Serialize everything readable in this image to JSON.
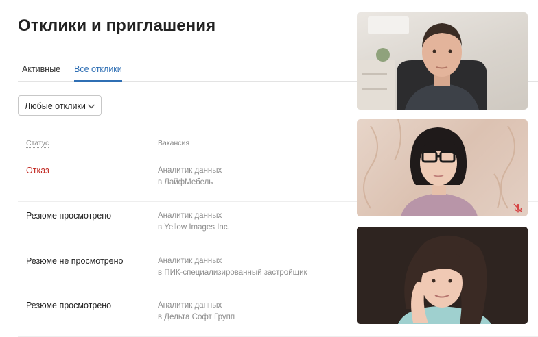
{
  "header": {
    "title": "Отклики и приглашения"
  },
  "tabs": [
    {
      "label": "Активные"
    },
    {
      "label": "Все отклики"
    }
  ],
  "filter": {
    "selected": "Любые отклики"
  },
  "table": {
    "columns": {
      "status": "Статус",
      "vacancy": "Вакансия"
    },
    "rows": [
      {
        "status": "Отказ",
        "vacancy": "Аналитик данных",
        "company": "в ЛайфМебель"
      },
      {
        "status": "Резюме просмотрено",
        "vacancy": "Аналитик данных",
        "company": "в Yellow Images Inc."
      },
      {
        "status": "Резюме не просмотрено",
        "vacancy": "Аналитик данных",
        "company": "в ПИК-специализированный застройщик"
      },
      {
        "status": "Резюме просмотрено",
        "vacancy": "Аналитик данных",
        "company": "в Дельта Софт Групп"
      }
    ]
  },
  "colors": {
    "accent": "#2f6fb4",
    "reject": "#c0261f",
    "muted_icon": "#d64545"
  },
  "video_call": {
    "tiles": [
      {
        "name": "participant-1-video"
      },
      {
        "name": "participant-2-video",
        "icon": "mic-off-icon"
      },
      {
        "name": "participant-3-video"
      }
    ]
  }
}
